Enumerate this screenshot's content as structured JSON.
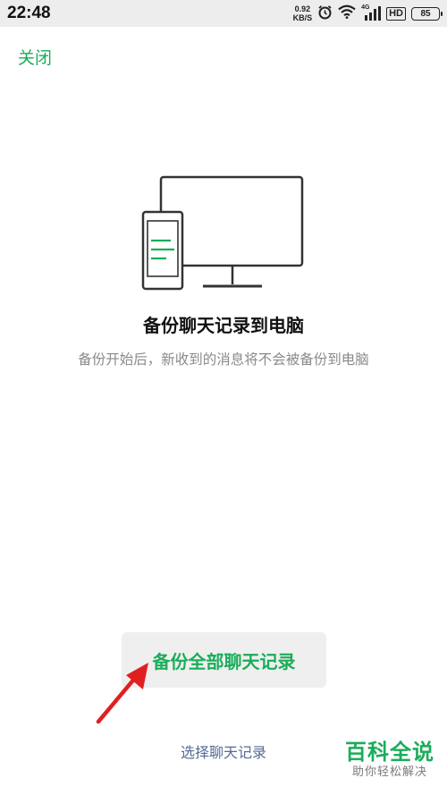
{
  "status_bar": {
    "time": "22:48",
    "net_speed_value": "0.92",
    "net_speed_unit": "KB/S",
    "network_type": "4G",
    "hd_label": "HD",
    "battery_level": "85",
    "icons": [
      "alarm-icon",
      "wifi-icon",
      "signal-icon",
      "battery-icon"
    ]
  },
  "header": {
    "close_label": "关闭"
  },
  "main": {
    "title": "备份聊天记录到电脑",
    "subtitle": "备份开始后，新收到的消息将不会被备份到电脑",
    "illustration_icon": "phone-and-monitor-icon"
  },
  "actions": {
    "backup_all_label": "备份全部聊天记录",
    "select_label": "选择聊天记录"
  },
  "annotation": {
    "icon": "red-arrow-icon"
  },
  "watermark": {
    "main": "百科全说",
    "sub": "助你轻松解决"
  },
  "colors": {
    "accent": "#1aad5a",
    "link": "#576b95",
    "arrow": "#e02020"
  }
}
